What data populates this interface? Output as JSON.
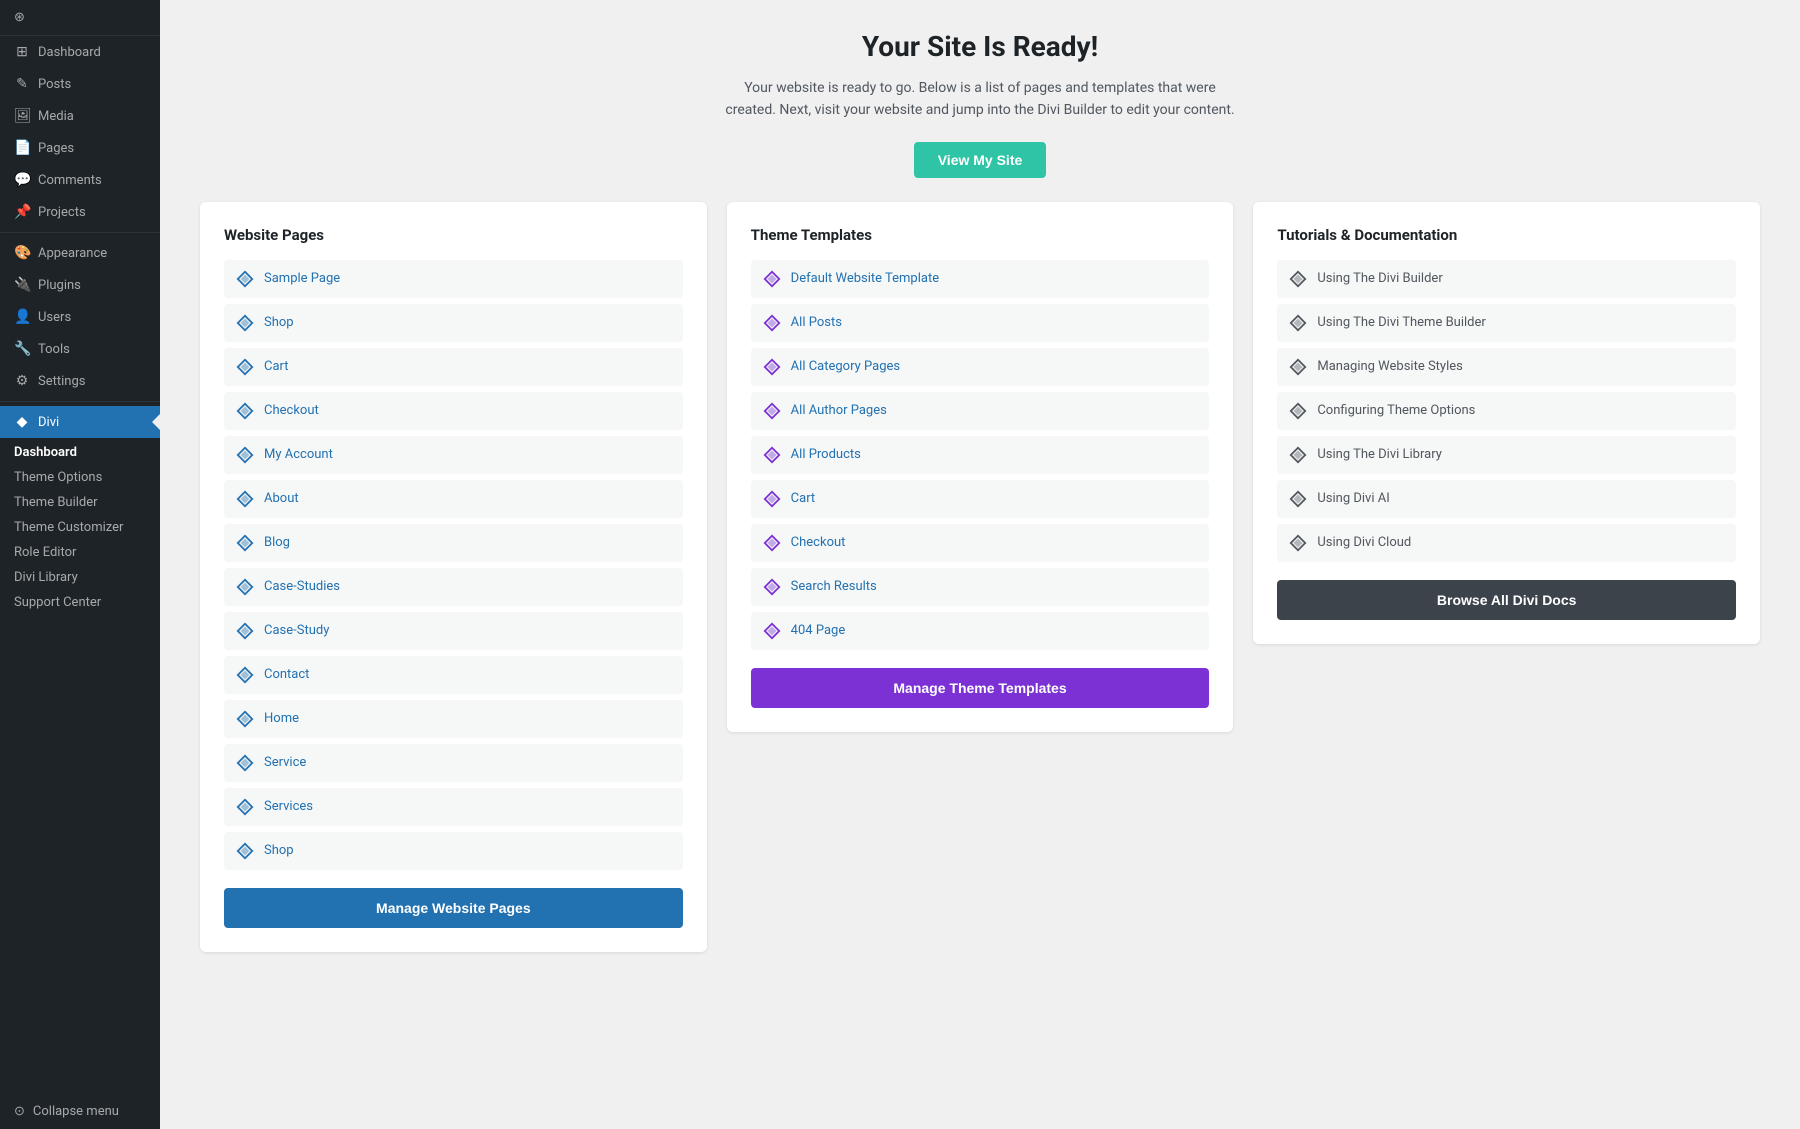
{
  "sidebar": {
    "items": [
      {
        "label": "Dashboard",
        "icon": "⊞",
        "active": false
      },
      {
        "label": "Posts",
        "icon": "✎",
        "active": false
      },
      {
        "label": "Media",
        "icon": "🖼",
        "active": false
      },
      {
        "label": "Pages",
        "icon": "📄",
        "active": false
      },
      {
        "label": "Comments",
        "icon": "💬",
        "active": false
      },
      {
        "label": "Projects",
        "icon": "📌",
        "active": false
      },
      {
        "label": "Appearance",
        "icon": "🎨",
        "active": false
      },
      {
        "label": "Plugins",
        "icon": "🔌",
        "active": false
      },
      {
        "label": "Users",
        "icon": "👤",
        "active": false
      },
      {
        "label": "Tools",
        "icon": "🔧",
        "active": false
      },
      {
        "label": "Settings",
        "icon": "⚙",
        "active": false
      }
    ],
    "divi_main": "Divi",
    "divi_sub_items": [
      {
        "label": "Dashboard",
        "active": true
      },
      {
        "label": "Theme Options",
        "active": false
      },
      {
        "label": "Theme Builder",
        "active": false
      },
      {
        "label": "Theme Customizer",
        "active": false
      },
      {
        "label": "Role Editor",
        "active": false
      },
      {
        "label": "Divi Library",
        "active": false
      },
      {
        "label": "Support Center",
        "active": false
      }
    ],
    "collapse_label": "Collapse menu"
  },
  "header": {
    "title": "Your Site Is Ready!",
    "subtitle": "Your website is ready to go. Below is a list of pages and templates that were created. Next, visit your website and jump into the Divi Builder to edit your content.",
    "view_site_btn": "View My Site"
  },
  "website_pages": {
    "title": "Website Pages",
    "items": [
      "Sample Page",
      "Shop",
      "Cart",
      "Checkout",
      "My Account",
      "About",
      "Blog",
      "Case-Studies",
      "Case-Study",
      "Contact",
      "Home",
      "Service",
      "Services",
      "Shop"
    ],
    "manage_btn": "Manage Website Pages"
  },
  "theme_templates": {
    "title": "Theme Templates",
    "items": [
      "Default Website Template",
      "All Posts",
      "All Category Pages",
      "All Author Pages",
      "All Products",
      "Cart",
      "Checkout",
      "Search Results",
      "404 Page"
    ],
    "manage_btn": "Manage Theme Templates"
  },
  "tutorials": {
    "title": "Tutorials & Documentation",
    "items": [
      "Using The Divi Builder",
      "Using The Divi Theme Builder",
      "Managing Website Styles",
      "Configuring Theme Options",
      "Using The Divi Library",
      "Using Divi AI",
      "Using Divi Cloud"
    ],
    "browse_btn": "Browse All Divi Docs"
  }
}
